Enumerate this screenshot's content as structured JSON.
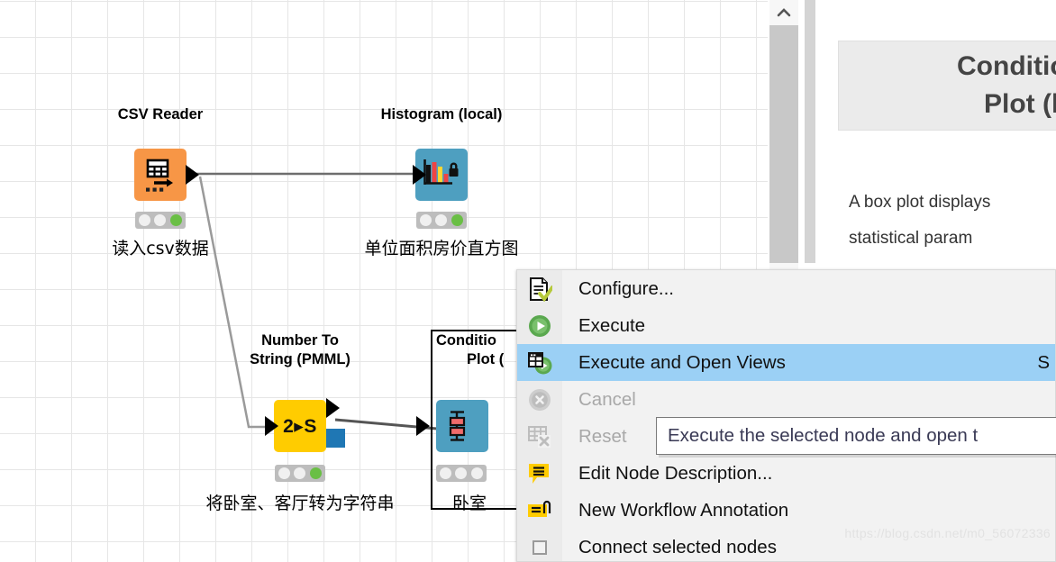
{
  "canvas": {
    "nodes": [
      {
        "id": "csv-reader",
        "title": "CSV Reader",
        "title_lines": [
          "CSV Reader"
        ],
        "label": "读入csv数据",
        "color": "#f79646",
        "glyph": "table-arrow-icon",
        "status": [
          "idle",
          "idle",
          "green"
        ]
      },
      {
        "id": "histogram-local",
        "title": "Histogram (local)",
        "title_lines": [
          "Histogram (local)"
        ],
        "label": "单位面积房价直方图",
        "color": "#4e9fc0",
        "glyph": "bar-chart-lock-icon",
        "status": [
          "idle",
          "idle",
          "green"
        ]
      },
      {
        "id": "number-to-string-pmml",
        "title": "Number To String (PMML)",
        "title_lines": [
          "Number To",
          "String (PMML)"
        ],
        "label": "将卧室、客厅转为字符串",
        "color": "#ffcc00",
        "glyph": "2-to-S-icon",
        "glyph_text": "2▸S",
        "status": [
          "idle",
          "idle",
          "green"
        ]
      },
      {
        "id": "conditional-box-plot-local",
        "title": "Conditional Box Plot (local)",
        "title_lines": [
          "Conditio",
          "Plot ("
        ],
        "label": "卧室",
        "color": "#4e9fc0",
        "glyph": "box-plot-icon",
        "status": [
          "idle",
          "idle",
          "idle"
        ],
        "selected": true
      }
    ]
  },
  "right_pane": {
    "description_title_lines": [
      "Conditional",
      "Plot (loca"
    ],
    "description_paragraph_lines": [
      "A  box  plot  displays",
      "statistical         param"
    ],
    "scroll_icon": "chevron-up-icon"
  },
  "context_menu": {
    "items": [
      {
        "label": "Configure...",
        "icon": "configure-icon",
        "accel": "",
        "state": "normal"
      },
      {
        "label": "Execute",
        "icon": "execute-icon",
        "accel": "",
        "state": "normal"
      },
      {
        "label": "Execute and Open Views",
        "icon": "execute-open-views-icon",
        "accel": "S",
        "state": "selected"
      },
      {
        "label": "Cancel",
        "icon": "cancel-icon",
        "accel": "",
        "state": "disabled"
      },
      {
        "label": "Reset",
        "icon": "reset-icon",
        "accel": "",
        "state": "disabled"
      },
      {
        "label": "Edit Node Description...",
        "icon": "edit-description-icon",
        "accel": "",
        "state": "normal"
      },
      {
        "label": "New Workflow Annotation",
        "icon": "new-annotation-icon",
        "accel": "",
        "state": "normal"
      },
      {
        "label": "Connect selected nodes",
        "icon": "checkbox-icon",
        "accel": "",
        "state": "normal"
      }
    ]
  },
  "tooltip": {
    "text": "Execute the selected node and open t"
  },
  "watermark": {
    "text": "https://blog.csdn.net/m0_56072336"
  }
}
